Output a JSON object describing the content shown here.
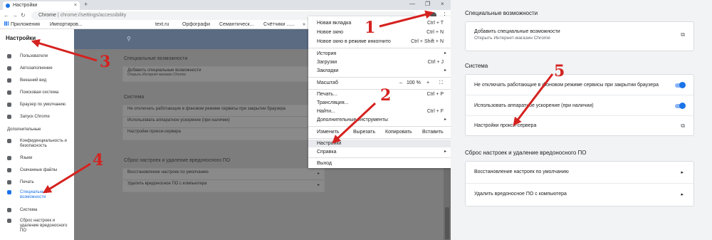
{
  "browser": {
    "tab_title": "Настройки",
    "tab_close": "×",
    "new_tab": "+",
    "window_controls": [
      "—",
      "❐",
      "×"
    ],
    "omnibox_prefix": "Chrome",
    "omnibox_url": "chrome://settings/accessibility",
    "bookmarks": [
      "Приложения",
      "Импортиров...",
      "text.ru",
      "Орфографи",
      "Семантическ...",
      "Счётчики ......"
    ],
    "bookmark_overflow": "»"
  },
  "sidebar": {
    "title": "Настройки",
    "items": [
      {
        "label": "Пользователи",
        "icon": "person-icon"
      },
      {
        "label": "Автозаполнение",
        "icon": "autofill-icon"
      },
      {
        "label": "Внешний вид",
        "icon": "palette-icon"
      },
      {
        "label": "Поисковая система",
        "icon": "search-icon"
      },
      {
        "label": "Браузер по умолчанию",
        "icon": "browser-icon"
      },
      {
        "label": "Запуск Chrome",
        "icon": "power-icon"
      }
    ],
    "section": "Дополнительные",
    "advanced_items": [
      {
        "label": "Конфиденциальность и безопасность",
        "icon": "shield-icon"
      },
      {
        "label": "Языки",
        "icon": "globe-icon"
      },
      {
        "label": "Скачанные файлы",
        "icon": "download-icon"
      },
      {
        "label": "Печать",
        "icon": "print-icon"
      },
      {
        "label": "Специальные возможности",
        "icon": "accessibility-icon",
        "active": true
      },
      {
        "label": "Система",
        "icon": "wrench-icon"
      },
      {
        "label": "Сброс настроек и удаление вредоносного ПО",
        "icon": "reset-icon"
      }
    ]
  },
  "dim_content": {
    "heading_accessibility": "Специальные возможности",
    "add_features": "Добавить специальные возможности",
    "add_features_sub": "Открыть Интернет-магазин Chrome",
    "heading_system": "Система",
    "background_apps": "Не отключать работающие в фоновом режиме сервисы при закрытии браузера",
    "hw_accel": "Использовать аппаратное ускорение (при наличии)",
    "proxy": "Настройки прокси-сервера",
    "heading_reset": "Сброс настроек и удаление вредоносного ПО",
    "restore": "Восстановление настроек по умолчанию",
    "cleanup": "Удалить вредоносное ПО с компьютера"
  },
  "menu": {
    "new_tab": {
      "label": "Новая вкладка",
      "shortcut": "Ctrl + T"
    },
    "new_window": {
      "label": "Новое окно",
      "shortcut": "Ctrl + N"
    },
    "incognito": {
      "label": "Новое окно в режиме инкогнито",
      "shortcut": "Ctrl + Shift + N"
    },
    "history": "История",
    "downloads": {
      "label": "Загрузки",
      "shortcut": "Ctrl + J"
    },
    "bookmarks": "Закладки",
    "zoom": {
      "label": "Масштаб",
      "minus": "–",
      "value": "100 %",
      "plus": "+",
      "fullscreen": "⛶"
    },
    "print": {
      "label": "Печать...",
      "shortcut": "Ctrl + P"
    },
    "cast": "Трансляция...",
    "find": {
      "label": "Найти...",
      "shortcut": "Ctrl + F"
    },
    "more_tools": "Дополнительные инструменты",
    "edit": {
      "label": "Изменить",
      "cut": "Вырезать",
      "copy": "Копировать",
      "paste": "Вставить"
    },
    "settings": "Настройки",
    "help": "Справка",
    "exit": "Выход"
  },
  "settings_panel": {
    "heading_accessibility": "Специальные возможности",
    "add_features": "Добавить специальные возможности",
    "add_features_sub": "Открыть Интернет-магазин Chrome",
    "heading_system": "Система",
    "background_apps": "Не отключать работающие в фоновом режиме сервисы при закрытии браузера",
    "hw_accel": "Использовать аппаратное ускорение (при наличии)",
    "proxy": "Настройки прокси-сервера",
    "heading_reset": "Сброс настроек и удаление вредоносного ПО",
    "restore": "Восстановление настроек по умолчанию",
    "cleanup": "Удалить вредоносное ПО с компьютера",
    "background_apps_on": true,
    "hw_accel_on": true
  },
  "annotations": {
    "numbers": [
      "1",
      "2",
      "3",
      "4",
      "5"
    ],
    "color": "#d5221f"
  }
}
